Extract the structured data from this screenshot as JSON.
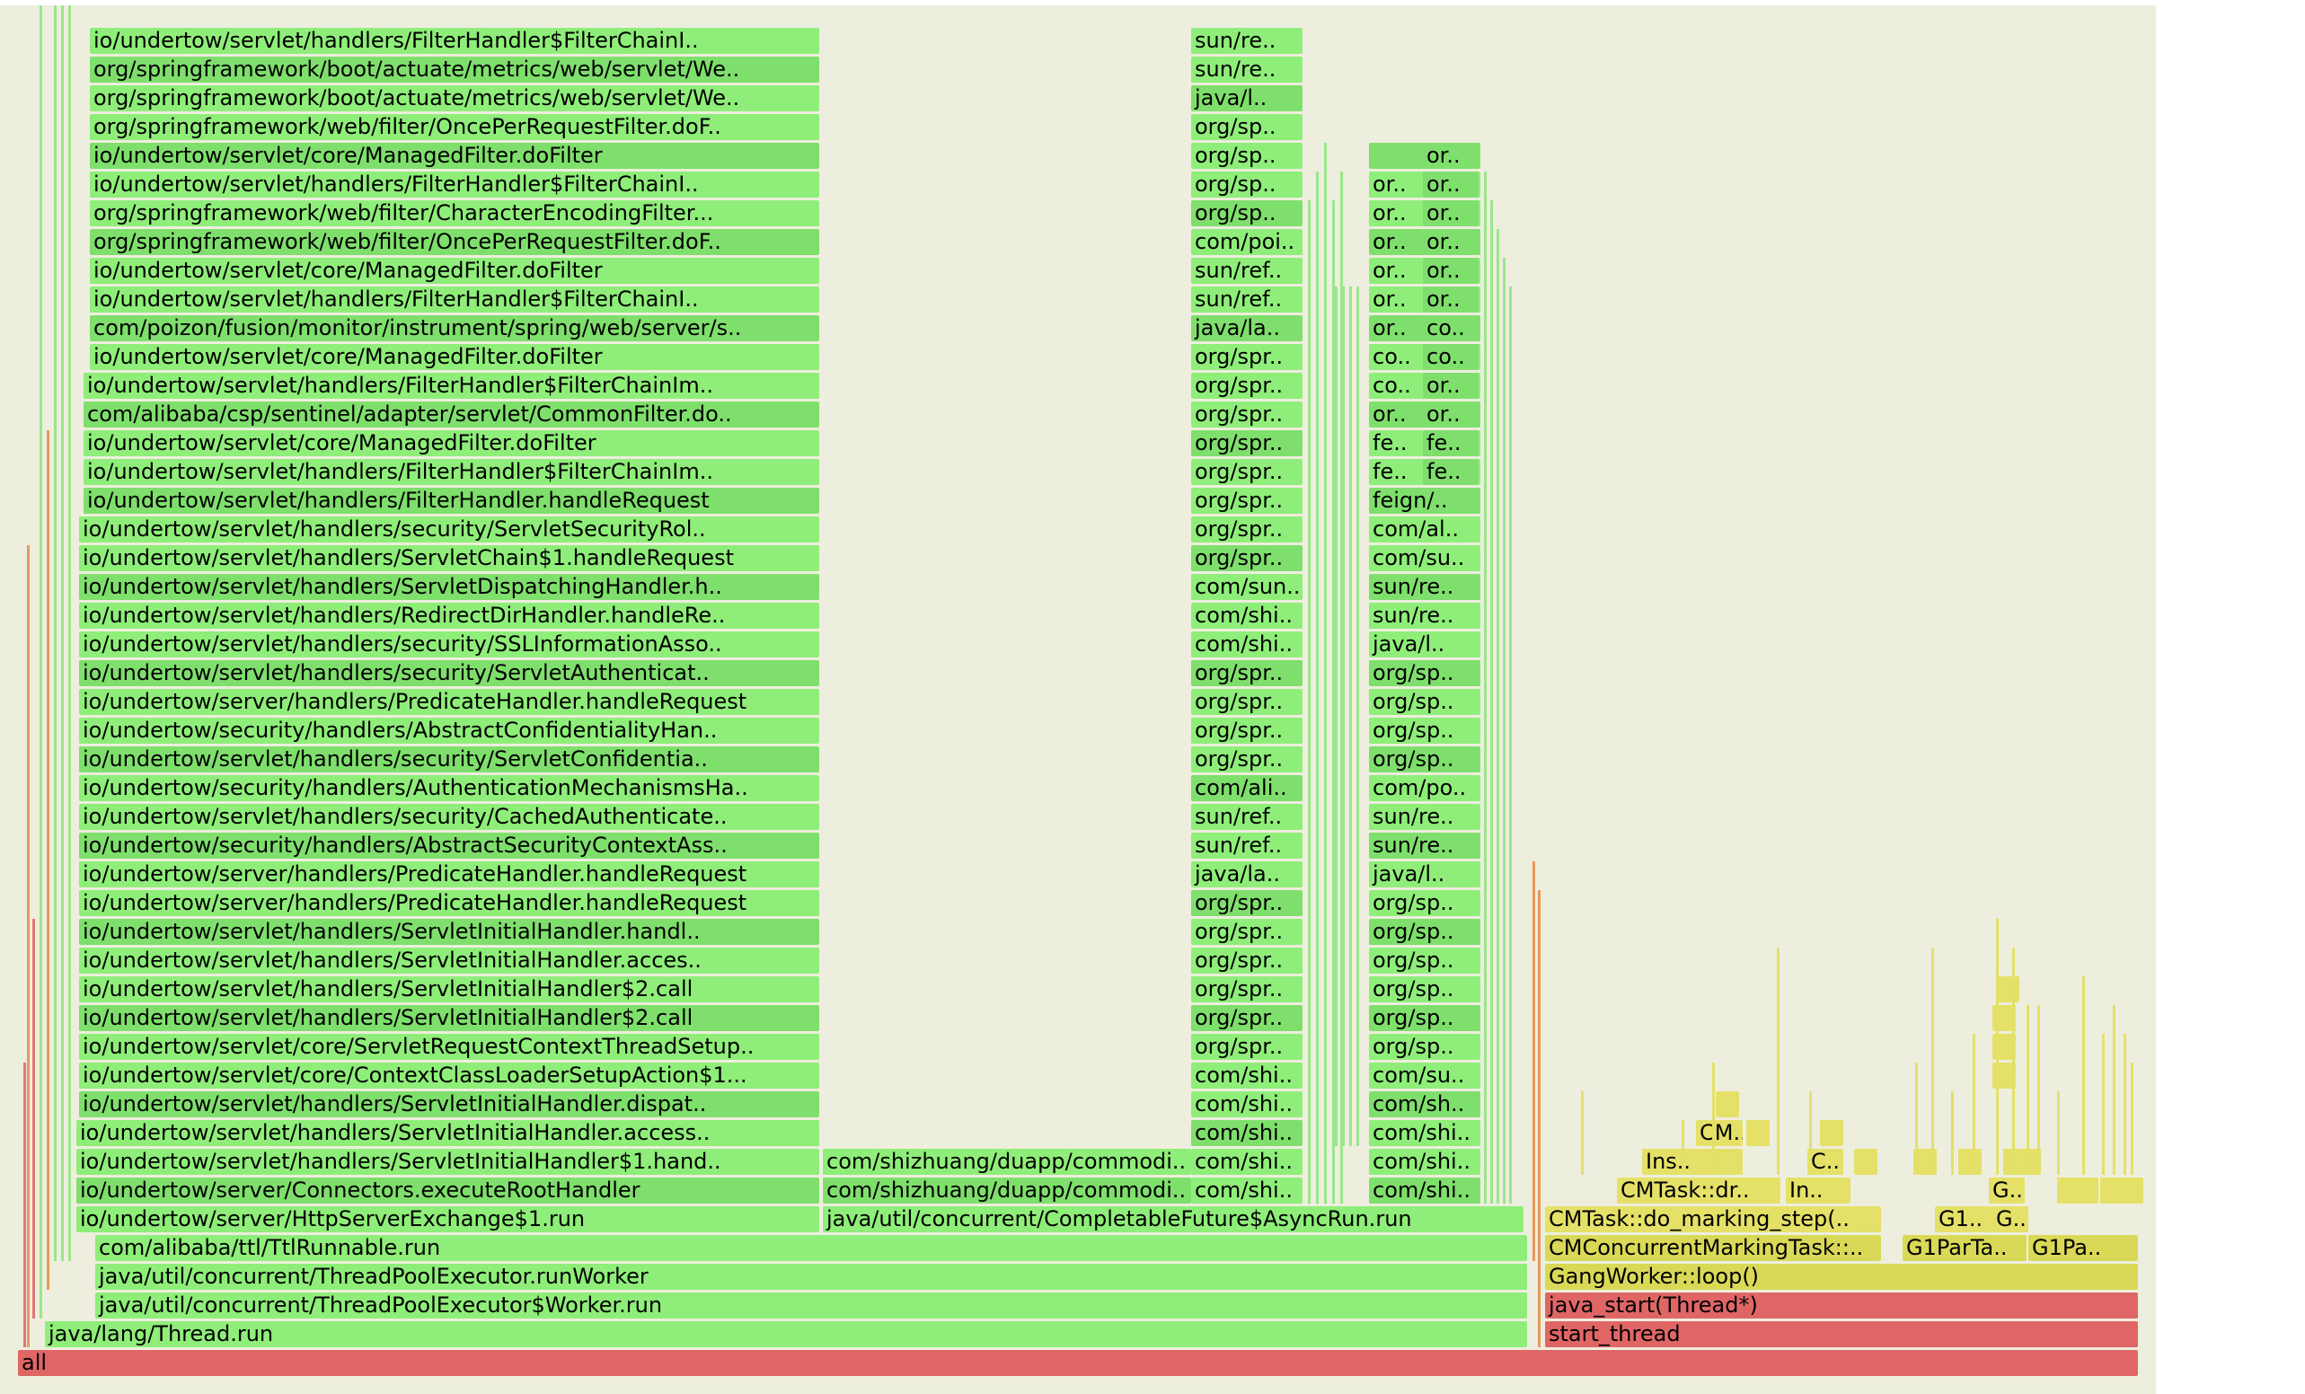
{
  "flamegraph": {
    "colors": {
      "green": "#8fee79",
      "green_dark": "#7fdf6c",
      "yellow": "#d9d957",
      "red": "#e06666",
      "background": "#eeeede"
    },
    "root": "all",
    "thread_stack": [
      "java/lang/Thread.run",
      "java/util/concurrent/ThreadPoolExecutor$Worker.run",
      "java/util/concurrent/ThreadPoolExecutor.runWorker",
      "com/alibaba/ttl/TtlRunnable.run"
    ],
    "main_column": [
      "io/undertow/server/HttpServerExchange$1.run",
      "io/undertow/server/Connectors.executeRootHandler",
      "io/undertow/servlet/handlers/ServletInitialHandler$1.hand..",
      "io/undertow/servlet/handlers/ServletInitialHandler.access..",
      "io/undertow/servlet/handlers/ServletInitialHandler.dispat..",
      "io/undertow/servlet/core/ContextClassLoaderSetupAction$1...",
      "io/undertow/servlet/core/ServletRequestContextThreadSetup..",
      "io/undertow/servlet/handlers/ServletInitialHandler$2.call",
      "io/undertow/servlet/handlers/ServletInitialHandler$2.call",
      "io/undertow/servlet/handlers/ServletInitialHandler.acces..",
      "io/undertow/servlet/handlers/ServletInitialHandler.handl..",
      "io/undertow/server/handlers/PredicateHandler.handleRequest",
      "io/undertow/server/handlers/PredicateHandler.handleRequest",
      "io/undertow/security/handlers/AbstractSecurityContextAss..",
      "io/undertow/servlet/handlers/security/CachedAuthenticate..",
      "io/undertow/security/handlers/AuthenticationMechanismsHa..",
      "io/undertow/servlet/handlers/security/ServletConfidentia..",
      "io/undertow/security/handlers/AbstractConfidentialityHan..",
      "io/undertow/server/handlers/PredicateHandler.handleRequest",
      "io/undertow/servlet/handlers/security/ServletAuthenticat..",
      "io/undertow/servlet/handlers/security/SSLInformationAsso..",
      "io/undertow/servlet/handlers/RedirectDirHandler.handleRe..",
      "io/undertow/servlet/handlers/ServletDispatchingHandler.h..",
      "io/undertow/servlet/handlers/ServletChain$1.handleRequest",
      "io/undertow/servlet/handlers/security/ServletSecurityRol..",
      "io/undertow/servlet/handlers/FilterHandler.handleRequest",
      "io/undertow/servlet/handlers/FilterHandler$FilterChainIm..",
      "io/undertow/servlet/core/ManagedFilter.doFilter",
      "com/alibaba/csp/sentinel/adapter/servlet/CommonFilter.do..",
      "io/undertow/servlet/handlers/FilterHandler$FilterChainIm..",
      "io/undertow/servlet/core/ManagedFilter.doFilter",
      "com/poizon/fusion/monitor/instrument/spring/web/server/s..",
      "io/undertow/servlet/handlers/FilterHandler$FilterChainI..",
      "io/undertow/servlet/core/ManagedFilter.doFilter",
      "org/springframework/web/filter/OncePerRequestFilter.doF..",
      "org/springframework/web/filter/CharacterEncodingFilter...",
      "io/undertow/servlet/handlers/FilterHandler$FilterChainI..",
      "io/undertow/servlet/core/ManagedFilter.doFilter",
      "org/springframework/web/filter/OncePerRequestFilter.doF..",
      "org/springframework/boot/actuate/metrics/web/servlet/We..",
      "org/springframework/boot/actuate/metrics/web/servlet/We..",
      "io/undertow/servlet/handlers/FilterHandler$FilterChainI.."
    ],
    "async_column": [
      "java/util/concurrent/CompletableFuture$AsyncRun.run",
      "com/shizhuang/duapp/commodi..",
      "com/shizhuang/duapp/commodi.."
    ],
    "column_c": [
      "com/shi..",
      "com/shi..",
      "com/shi..",
      "com/shi..",
      "com/shi..",
      "org/spr..",
      "org/spr..",
      "org/spr..",
      "org/spr..",
      "org/spr..",
      "org/spr..",
      "java/la..",
      "sun/ref..",
      "sun/ref..",
      "com/ali..",
      "org/spr..",
      "org/spr..",
      "org/spr..",
      "org/spr..",
      "com/shi..",
      "com/shi..",
      "com/sun..",
      "org/spr..",
      "org/spr..",
      "org/spr..",
      "org/spr..",
      "org/spr..",
      "org/spr..",
      "org/spr..",
      "org/spr..",
      "java/la..",
      "sun/ref..",
      "sun/ref..",
      "com/poi..",
      "org/sp..",
      "org/sp..",
      "org/sp..",
      "org/sp..",
      "java/l..",
      "sun/re..",
      "sun/re.."
    ],
    "column_d": [
      "com/shi..",
      "com/shi..",
      "com/shi..",
      "com/sh..",
      "com/su..",
      "org/sp..",
      "org/sp..",
      "org/sp..",
      "org/sp..",
      "org/sp..",
      "org/sp..",
      "java/l..",
      "sun/re..",
      "sun/re..",
      "com/po..",
      "org/sp..",
      "org/sp..",
      "org/sp..",
      "org/sp..",
      "java/l..",
      "sun/re..",
      "sun/re..",
      "com/su..",
      "com/al..",
      "feign/..",
      "fe..",
      "fe..",
      "or..",
      "co..",
      "co..",
      "or..",
      "or..",
      "or..",
      "or..",
      "or..",
      "or..",
      ""
    ],
    "column_e": [
      "fe..",
      "fe..",
      "or..",
      "or..",
      "co..",
      "co..",
      "or..",
      "or..",
      "or..",
      "or..",
      "or..",
      "or.."
    ],
    "jvm_stack": [
      {
        "label": "start_thread",
        "color": "red"
      },
      {
        "label": "java_start(Thread*)",
        "color": "red"
      },
      {
        "label": "GangWorker::loop()",
        "color": "yellow"
      }
    ],
    "jvm_row3": [
      "CMConcurrentMarkingTask::..",
      "G1ParTa..",
      "G1Pa.."
    ],
    "jvm_row4": [
      "CMTask::do_marking_step(..",
      "G1..",
      "G.."
    ],
    "jvm_row5": [
      "CMTask::dr..",
      "In..",
      "G.."
    ],
    "jvm_row6": [
      "Ins..",
      "C.."
    ],
    "jvm_row7": [
      "CM.."
    ]
  }
}
